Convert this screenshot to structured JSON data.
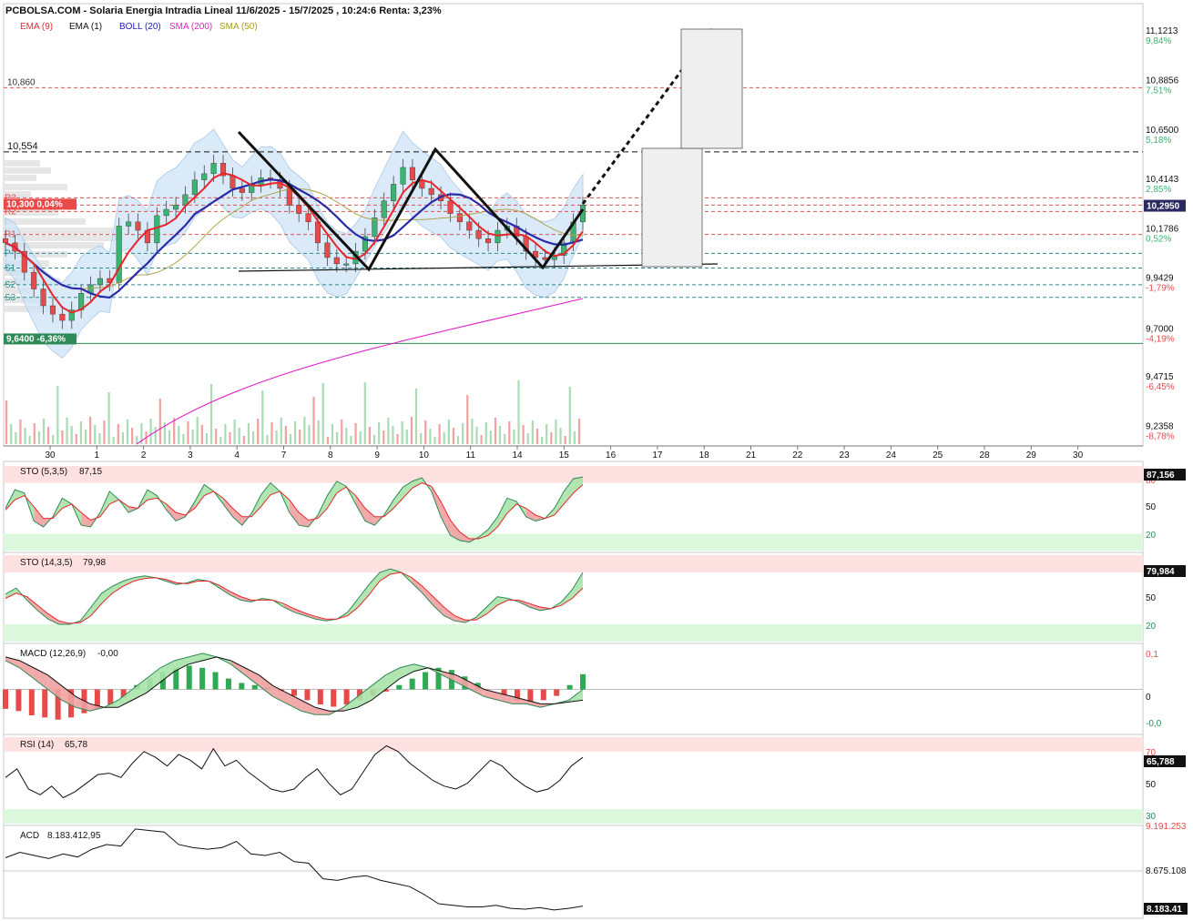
{
  "header": {
    "title": "PCBOLSA.COM - Solaria Energia Intradia Lineal 11/6/2025 - 15/7/2025 , 10:24:6 Renta: 3,23%",
    "legend": [
      {
        "label": "EMA (9)",
        "color": "#e8262a"
      },
      {
        "label": "EMA (1)",
        "color": "#111111"
      },
      {
        "label": "BOLL (20)",
        "color": "#2222aa"
      },
      {
        "label": "SMA (200)",
        "color": "#e020c8"
      },
      {
        "label": "SMA (50)",
        "color": "#a8a020"
      }
    ]
  },
  "colors": {
    "up": "#3cb371",
    "down": "#e84a4a",
    "boll_fill": "#cde3f7",
    "ema9": "#e8262a",
    "boll_mid": "#2a2aa8",
    "sma200": "#e020c8",
    "sma50": "#b0a44a",
    "overbought": "#fde0e0",
    "oversold": "#dcf8dc"
  },
  "chart_data": [
    {
      "type": "candlestick",
      "name": "price",
      "x_ticks": [
        "30",
        "1",
        "2",
        "3",
        "4",
        "7",
        "8",
        "9",
        "10",
        "11",
        "14",
        "15",
        "16",
        "17",
        "18",
        "21",
        "22",
        "23",
        "24",
        "25",
        "28",
        "29",
        "30"
      ],
      "y_ticks": [
        {
          "value": "11,1213",
          "pct": "9,84%"
        },
        {
          "value": "10,8856",
          "pct": "7,51%"
        },
        {
          "value": "10,6500",
          "pct": "5,18%"
        },
        {
          "value": "10,4143",
          "pct": "2,85%"
        },
        {
          "value": "10,1786",
          "pct": "0,52%"
        },
        {
          "value": "9,9429",
          "pct": "-1,79%"
        },
        {
          "value": "9,7000",
          "pct": "-4,19%"
        },
        {
          "value": "9,4715",
          "pct": "-6,45%"
        },
        {
          "value": "9,2358",
          "pct": "-8,78%"
        }
      ],
      "ylim": [
        9.16,
        11.17
      ],
      "last_price": "10,2950",
      "levels": [
        {
          "label": "10,860",
          "value": 10.86,
          "style": "red-dash"
        },
        {
          "label": "10,554",
          "value": 10.554,
          "style": "black-dash"
        },
        {
          "label": "10,300 0,04%",
          "value": 10.3,
          "style": "red-dash"
        },
        {
          "label": "R3",
          "value": 10.335,
          "style": "red-dash"
        },
        {
          "label": "R2",
          "value": 10.27,
          "style": "red-dash"
        },
        {
          "label": "R1",
          "value": 10.16,
          "style": "red-dash"
        },
        {
          "label": "P",
          "value": 10.07,
          "style": "teal-dash"
        },
        {
          "label": "S1",
          "value": 10.0,
          "style": "teal-dash"
        },
        {
          "label": "S2",
          "value": 9.92,
          "style": "teal-dash"
        },
        {
          "label": "S3",
          "value": 9.86,
          "style": "teal-dash"
        },
        {
          "label": "9,6400 -6,36%",
          "value": 9.64,
          "style": "green-solid"
        }
      ],
      "close_series": [
        10.12,
        10.08,
        9.98,
        9.9,
        9.82,
        9.78,
        9.75,
        9.8,
        9.88,
        9.92,
        9.95,
        9.93,
        10.2,
        10.22,
        10.18,
        10.12,
        10.25,
        10.28,
        10.3,
        10.35,
        10.42,
        10.45,
        10.5,
        10.44,
        10.38,
        10.36,
        10.4,
        10.43,
        10.42,
        10.38,
        10.3,
        10.26,
        10.22,
        10.12,
        10.05,
        10.02,
        10.02,
        10.08,
        10.15,
        10.24,
        10.32,
        10.4,
        10.48,
        10.42,
        10.38,
        10.35,
        10.32,
        10.26,
        10.22,
        10.18,
        10.14,
        10.12,
        10.18,
        10.2,
        10.15,
        10.08,
        10.05,
        10.04,
        10.06,
        10.12,
        10.22,
        10.3
      ]
    },
    {
      "type": "line",
      "name": "STO (5,3,5)",
      "label": "STO (5,3,5)",
      "value_label": "87,15",
      "last": "87,156",
      "y_ticks": [
        "80",
        "50",
        "20"
      ],
      "ylim": [
        0,
        100
      ],
      "k": [
        50,
        72,
        68,
        35,
        28,
        40,
        62,
        55,
        30,
        28,
        45,
        70,
        60,
        45,
        50,
        72,
        65,
        48,
        35,
        40,
        58,
        78,
        70,
        55,
        40,
        30,
        44,
        66,
        80,
        70,
        45,
        30,
        28,
        42,
        65,
        82,
        76,
        55,
        35,
        30,
        42,
        60,
        75,
        82,
        86,
        70,
        40,
        18,
        12,
        10,
        16,
        25,
        40,
        62,
        58,
        40,
        35,
        38,
        50,
        70,
        85,
        87
      ],
      "d": [
        48,
        60,
        65,
        52,
        38,
        38,
        50,
        55,
        45,
        36,
        40,
        55,
        60,
        52,
        50,
        60,
        62,
        55,
        45,
        42,
        50,
        65,
        70,
        62,
        50,
        40,
        40,
        52,
        66,
        70,
        60,
        45,
        36,
        38,
        50,
        68,
        75,
        65,
        50,
        40,
        40,
        50,
        62,
        74,
        80,
        76,
        58,
        36,
        22,
        14,
        14,
        18,
        28,
        44,
        55,
        50,
        42,
        38,
        42,
        55,
        68,
        78
      ]
    },
    {
      "type": "line",
      "name": "STO (14,3,5)",
      "label": "STO (14,3,5)",
      "value_label": "79,98",
      "last": "79,984",
      "y_ticks": [
        "80",
        "50",
        "20"
      ],
      "ylim": [
        0,
        100
      ],
      "k": [
        55,
        62,
        48,
        36,
        26,
        20,
        20,
        24,
        40,
        56,
        64,
        70,
        74,
        76,
        74,
        70,
        66,
        68,
        72,
        70,
        62,
        54,
        48,
        46,
        50,
        48,
        40,
        34,
        30,
        26,
        24,
        26,
        34,
        50,
        66,
        80,
        84,
        80,
        68,
        56,
        42,
        30,
        24,
        22,
        28,
        40,
        52,
        50,
        46,
        40,
        36,
        38,
        46,
        60,
        80
      ],
      "d": [
        50,
        56,
        52,
        42,
        32,
        24,
        21,
        22,
        30,
        44,
        56,
        64,
        70,
        73,
        74,
        72,
        68,
        67,
        70,
        70,
        65,
        58,
        52,
        48,
        48,
        48,
        44,
        38,
        33,
        29,
        26,
        26,
        30,
        40,
        54,
        70,
        78,
        80,
        74,
        64,
        52,
        40,
        30,
        25,
        25,
        32,
        42,
        48,
        48,
        44,
        40,
        38,
        42,
        50,
        62
      ]
    },
    {
      "type": "bar+line",
      "name": "MACD (12,26,9)",
      "label": "MACD (12,26,9)",
      "value_label": "-0,00",
      "y_ticks": [
        "0,1",
        "0",
        "-0,0"
      ],
      "ylim": [
        -0.12,
        0.12
      ],
      "hist": [
        -0.018,
        -0.02,
        -0.024,
        -0.026,
        -0.028,
        -0.026,
        -0.022,
        -0.018,
        -0.014,
        -0.008,
        0.004,
        0.01,
        0.016,
        0.02,
        0.022,
        0.02,
        0.016,
        0.01,
        0.006,
        0.004,
        0.002,
        -0.002,
        -0.006,
        -0.01,
        -0.014,
        -0.016,
        -0.014,
        -0.01,
        -0.006,
        -0.002,
        0.004,
        0.01,
        0.016,
        0.02,
        0.018,
        0.012,
        0.006,
        0.0,
        -0.006,
        -0.01,
        -0.012,
        -0.01,
        -0.006,
        0.004,
        0.014
      ],
      "macd": [
        0.08,
        0.06,
        0.03,
        0.0,
        -0.03,
        -0.05,
        -0.06,
        -0.05,
        -0.03,
        0.0,
        0.03,
        0.06,
        0.08,
        0.09,
        0.1,
        0.09,
        0.07,
        0.04,
        0.01,
        -0.02,
        -0.04,
        -0.06,
        -0.07,
        -0.07,
        -0.05,
        -0.02,
        0.01,
        0.04,
        0.06,
        0.07,
        0.06,
        0.04,
        0.02,
        0.0,
        -0.02,
        -0.03,
        -0.04,
        -0.04,
        -0.05,
        -0.04,
        -0.03,
        0.0
      ],
      "signal": [
        0.09,
        0.08,
        0.06,
        0.04,
        0.01,
        -0.02,
        -0.04,
        -0.05,
        -0.05,
        -0.03,
        -0.01,
        0.02,
        0.05,
        0.07,
        0.08,
        0.09,
        0.08,
        0.06,
        0.04,
        0.01,
        -0.01,
        -0.03,
        -0.05,
        -0.06,
        -0.06,
        -0.05,
        -0.03,
        0.0,
        0.03,
        0.05,
        0.06,
        0.05,
        0.04,
        0.02,
        0.0,
        -0.01,
        -0.02,
        -0.03,
        -0.04,
        -0.04,
        -0.035,
        -0.03
      ]
    },
    {
      "type": "line",
      "name": "RSI (14)",
      "label": "RSI (14)",
      "value_label": "65,78",
      "last": "65,788",
      "y_ticks": [
        "70",
        "50",
        "30"
      ],
      "ylim": [
        20,
        80
      ],
      "values": [
        52,
        58,
        44,
        40,
        46,
        38,
        42,
        48,
        54,
        55,
        52,
        62,
        70,
        66,
        60,
        68,
        64,
        58,
        72,
        60,
        64,
        56,
        50,
        44,
        42,
        44,
        52,
        58,
        48,
        40,
        44,
        56,
        68,
        74,
        70,
        62,
        56,
        50,
        46,
        44,
        48,
        56,
        64,
        60,
        52,
        46,
        42,
        44,
        50,
        60,
        66
      ]
    },
    {
      "type": "line",
      "name": "ACD",
      "label": "ACD",
      "value_label": "8.183.412,95",
      "last": "8.183.41",
      "y_ticks": [
        "9.191.253",
        "8.675.108"
      ],
      "ylim": [
        8.12,
        9.23
      ],
      "values": [
        8.85,
        8.92,
        8.88,
        8.84,
        8.9,
        8.86,
        8.96,
        9.02,
        9.0,
        9.22,
        9.2,
        9.18,
        9.02,
        8.98,
        8.96,
        8.98,
        9.06,
        8.9,
        8.88,
        8.92,
        8.8,
        8.78,
        8.58,
        8.56,
        8.6,
        8.62,
        8.56,
        8.52,
        8.48,
        8.38,
        8.26,
        8.24,
        8.22,
        8.22,
        8.24,
        8.2,
        8.19,
        8.21,
        8.18,
        8.2,
        8.23
      ]
    }
  ]
}
